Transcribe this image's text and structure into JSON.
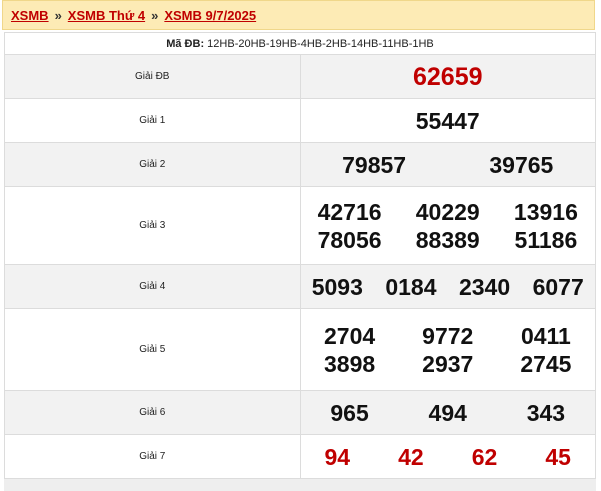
{
  "breadcrumb": {
    "items": [
      "XSMB",
      "XSMB Thứ 4",
      "XSMB 9/7/2025"
    ],
    "separator": "»"
  },
  "ma_db": {
    "label": "Mã ĐB:",
    "value": "12HB-20HB-19HB-4HB-2HB-14HB-11HB-1HB"
  },
  "prizes": [
    {
      "label": "Giải ĐB",
      "numbers": [
        "62659"
      ]
    },
    {
      "label": "Giải 1",
      "numbers": [
        "55447"
      ]
    },
    {
      "label": "Giải 2",
      "numbers": [
        "79857",
        "39765"
      ]
    },
    {
      "label": "Giải 3",
      "numbers": [
        "42716",
        "40229",
        "13916",
        "78056",
        "88389",
        "51186"
      ]
    },
    {
      "label": "Giải 4",
      "numbers": [
        "5093",
        "0184",
        "2340",
        "6077"
      ]
    },
    {
      "label": "Giải 5",
      "numbers": [
        "2704",
        "9772",
        "0411",
        "3898",
        "2937",
        "2745"
      ]
    },
    {
      "label": "Giải 6",
      "numbers": [
        "965",
        "494",
        "343"
      ]
    },
    {
      "label": "Giải 7",
      "numbers": [
        "94",
        "42",
        "62",
        "45"
      ]
    }
  ],
  "colors": {
    "highlight": "#c00000",
    "breadcrumb_bg": "#fdebb5"
  }
}
